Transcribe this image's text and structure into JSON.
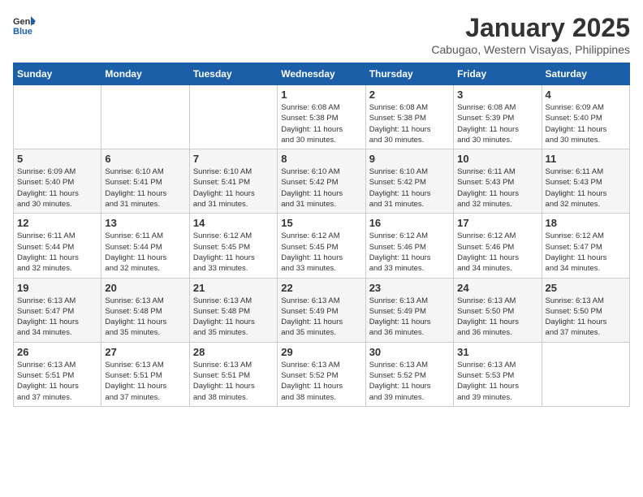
{
  "logo": {
    "general": "General",
    "blue": "Blue"
  },
  "calendar": {
    "title": "January 2025",
    "subtitle": "Cabugao, Western Visayas, Philippines"
  },
  "weekdays": [
    "Sunday",
    "Monday",
    "Tuesday",
    "Wednesday",
    "Thursday",
    "Friday",
    "Saturday"
  ],
  "weeks": [
    [
      {
        "day": "",
        "info": ""
      },
      {
        "day": "",
        "info": ""
      },
      {
        "day": "",
        "info": ""
      },
      {
        "day": "1",
        "info": "Sunrise: 6:08 AM\nSunset: 5:38 PM\nDaylight: 11 hours\nand 30 minutes."
      },
      {
        "day": "2",
        "info": "Sunrise: 6:08 AM\nSunset: 5:38 PM\nDaylight: 11 hours\nand 30 minutes."
      },
      {
        "day": "3",
        "info": "Sunrise: 6:08 AM\nSunset: 5:39 PM\nDaylight: 11 hours\nand 30 minutes."
      },
      {
        "day": "4",
        "info": "Sunrise: 6:09 AM\nSunset: 5:40 PM\nDaylight: 11 hours\nand 30 minutes."
      }
    ],
    [
      {
        "day": "5",
        "info": "Sunrise: 6:09 AM\nSunset: 5:40 PM\nDaylight: 11 hours\nand 30 minutes."
      },
      {
        "day": "6",
        "info": "Sunrise: 6:10 AM\nSunset: 5:41 PM\nDaylight: 11 hours\nand 31 minutes."
      },
      {
        "day": "7",
        "info": "Sunrise: 6:10 AM\nSunset: 5:41 PM\nDaylight: 11 hours\nand 31 minutes."
      },
      {
        "day": "8",
        "info": "Sunrise: 6:10 AM\nSunset: 5:42 PM\nDaylight: 11 hours\nand 31 minutes."
      },
      {
        "day": "9",
        "info": "Sunrise: 6:10 AM\nSunset: 5:42 PM\nDaylight: 11 hours\nand 31 minutes."
      },
      {
        "day": "10",
        "info": "Sunrise: 6:11 AM\nSunset: 5:43 PM\nDaylight: 11 hours\nand 32 minutes."
      },
      {
        "day": "11",
        "info": "Sunrise: 6:11 AM\nSunset: 5:43 PM\nDaylight: 11 hours\nand 32 minutes."
      }
    ],
    [
      {
        "day": "12",
        "info": "Sunrise: 6:11 AM\nSunset: 5:44 PM\nDaylight: 11 hours\nand 32 minutes."
      },
      {
        "day": "13",
        "info": "Sunrise: 6:11 AM\nSunset: 5:44 PM\nDaylight: 11 hours\nand 32 minutes."
      },
      {
        "day": "14",
        "info": "Sunrise: 6:12 AM\nSunset: 5:45 PM\nDaylight: 11 hours\nand 33 minutes."
      },
      {
        "day": "15",
        "info": "Sunrise: 6:12 AM\nSunset: 5:45 PM\nDaylight: 11 hours\nand 33 minutes."
      },
      {
        "day": "16",
        "info": "Sunrise: 6:12 AM\nSunset: 5:46 PM\nDaylight: 11 hours\nand 33 minutes."
      },
      {
        "day": "17",
        "info": "Sunrise: 6:12 AM\nSunset: 5:46 PM\nDaylight: 11 hours\nand 34 minutes."
      },
      {
        "day": "18",
        "info": "Sunrise: 6:12 AM\nSunset: 5:47 PM\nDaylight: 11 hours\nand 34 minutes."
      }
    ],
    [
      {
        "day": "19",
        "info": "Sunrise: 6:13 AM\nSunset: 5:47 PM\nDaylight: 11 hours\nand 34 minutes."
      },
      {
        "day": "20",
        "info": "Sunrise: 6:13 AM\nSunset: 5:48 PM\nDaylight: 11 hours\nand 35 minutes."
      },
      {
        "day": "21",
        "info": "Sunrise: 6:13 AM\nSunset: 5:48 PM\nDaylight: 11 hours\nand 35 minutes."
      },
      {
        "day": "22",
        "info": "Sunrise: 6:13 AM\nSunset: 5:49 PM\nDaylight: 11 hours\nand 35 minutes."
      },
      {
        "day": "23",
        "info": "Sunrise: 6:13 AM\nSunset: 5:49 PM\nDaylight: 11 hours\nand 36 minutes."
      },
      {
        "day": "24",
        "info": "Sunrise: 6:13 AM\nSunset: 5:50 PM\nDaylight: 11 hours\nand 36 minutes."
      },
      {
        "day": "25",
        "info": "Sunrise: 6:13 AM\nSunset: 5:50 PM\nDaylight: 11 hours\nand 37 minutes."
      }
    ],
    [
      {
        "day": "26",
        "info": "Sunrise: 6:13 AM\nSunset: 5:51 PM\nDaylight: 11 hours\nand 37 minutes."
      },
      {
        "day": "27",
        "info": "Sunrise: 6:13 AM\nSunset: 5:51 PM\nDaylight: 11 hours\nand 37 minutes."
      },
      {
        "day": "28",
        "info": "Sunrise: 6:13 AM\nSunset: 5:51 PM\nDaylight: 11 hours\nand 38 minutes."
      },
      {
        "day": "29",
        "info": "Sunrise: 6:13 AM\nSunset: 5:52 PM\nDaylight: 11 hours\nand 38 minutes."
      },
      {
        "day": "30",
        "info": "Sunrise: 6:13 AM\nSunset: 5:52 PM\nDaylight: 11 hours\nand 39 minutes."
      },
      {
        "day": "31",
        "info": "Sunrise: 6:13 AM\nSunset: 5:53 PM\nDaylight: 11 hours\nand 39 minutes."
      },
      {
        "day": "",
        "info": ""
      }
    ]
  ]
}
